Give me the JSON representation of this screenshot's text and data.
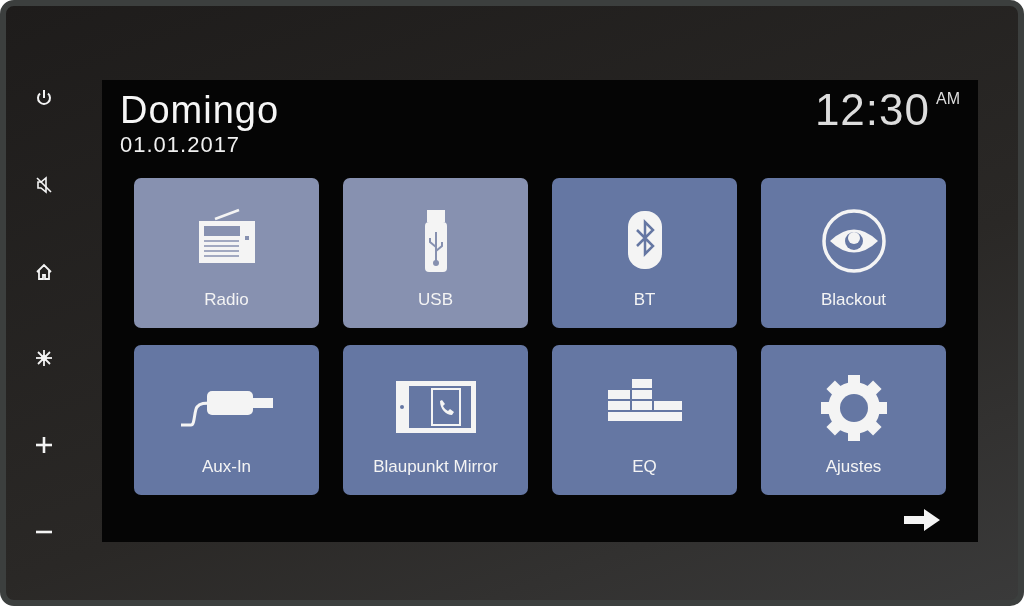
{
  "side_buttons": [
    {
      "kind": "power"
    },
    {
      "kind": "mute"
    },
    {
      "kind": "home"
    },
    {
      "kind": "brightness"
    },
    {
      "kind": "volume_up"
    },
    {
      "kind": "volume_down"
    }
  ],
  "screen": {
    "day": "Domingo",
    "date": "01.01.2017",
    "time": "12:30",
    "meridiem": "AM",
    "tiles": [
      {
        "label": "Radio",
        "kind": "radio"
      },
      {
        "label": "USB",
        "kind": "usb"
      },
      {
        "label": "BT",
        "kind": "bluetooth"
      },
      {
        "label": "Blackout",
        "kind": "eye"
      },
      {
        "label": "Aux-In",
        "kind": "aux"
      },
      {
        "label": "Blaupunkt Mirror",
        "kind": "mirror"
      },
      {
        "label": "EQ",
        "kind": "eq"
      },
      {
        "label": "Ajustes",
        "kind": "gear"
      }
    ]
  }
}
